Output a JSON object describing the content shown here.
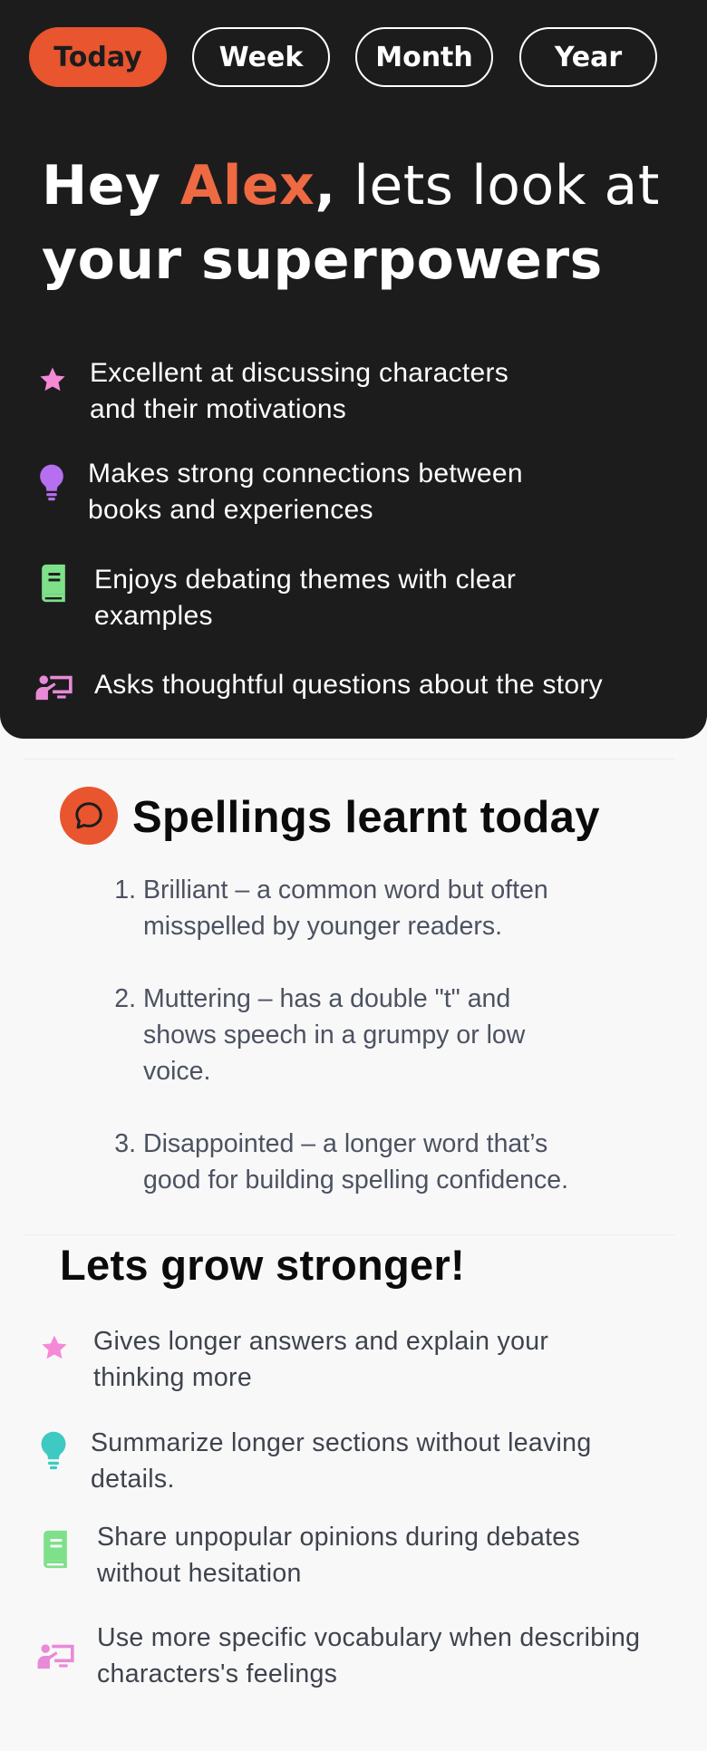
{
  "tabs": [
    "Today",
    "Week",
    "Month",
    "Year"
  ],
  "hero": {
    "greeting": "Hey ",
    "name": "Alex",
    "comma": ",",
    "rest_line1": " lets look at",
    "line2": "your superpowers"
  },
  "superpowers": [
    {
      "icon": "star-icon",
      "line1": "Excellent at discussing characters",
      "line2": "and their motivations",
      "color": "#f589d6"
    },
    {
      "icon": "lightbulb-icon",
      "line1": "Makes strong connections between",
      "line2": "books and experiences",
      "color": "#b56ff0"
    },
    {
      "icon": "book-icon",
      "line1": "Enjoys debating themes with clear",
      "line2": "examples",
      "color": "#7fe08a"
    },
    {
      "icon": "presentation-icon",
      "line1": "Asks thoughtful questions about the story",
      "line2": "",
      "color": "#e88ad8"
    }
  ],
  "spellings": {
    "title": "Spellings learnt today",
    "icon": "chat-bubble-icon",
    "items": [
      {
        "num": "1.",
        "line1": "Brilliant – a common word but often",
        "line2": "misspelled by younger readers.",
        "line3": ""
      },
      {
        "num": "2.",
        "line1": "Muttering – has a double \"t\" and",
        "line2": "shows speech in a grumpy or low",
        "line3": "voice."
      },
      {
        "num": "3.",
        "line1": "Disappointed – a longer word that’s",
        "line2": "good for building spelling confidence.",
        "line3": ""
      }
    ]
  },
  "grow": {
    "title": "Lets grow stronger!",
    "items": [
      {
        "icon": "star-icon",
        "line1": "Gives longer answers and explain your",
        "line2": "thinking more",
        "color": "#f589d6"
      },
      {
        "icon": "lightbulb-icon",
        "line1": "Summarize longer sections without leaving",
        "line2": "details.",
        "color": "#3ec9c2"
      },
      {
        "icon": "book-icon",
        "line1": "Share unpopular opinions during debates",
        "line2": "without hesitation",
        "color": "#7fe08a"
      },
      {
        "icon": "presentation-icon",
        "line1": "Use more specific vocabulary when describing",
        "line2": "characters's feelings",
        "color": "#e88ad8"
      }
    ]
  }
}
